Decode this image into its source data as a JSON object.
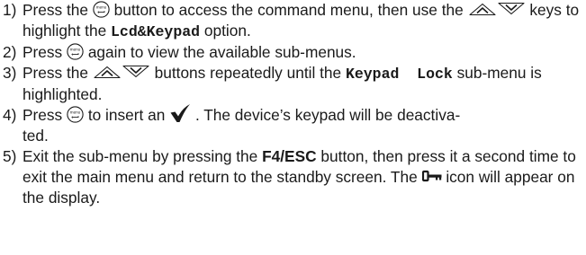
{
  "steps": [
    {
      "num": "1)",
      "t1": "Press the",
      "t2": "button to access the command menu, then use the",
      "t3": "keys to highlight the",
      "code": "Lcd&Keypad",
      "t4": "option."
    },
    {
      "num": "2)",
      "t1": "Press",
      "t2": "again to view the available sub-menus."
    },
    {
      "num": "3)",
      "t1": "Press the",
      "t2": "buttons repeatedly until the",
      "code": "Keypad  Lock",
      "t3": "sub-menu is highlighted."
    },
    {
      "num": "4)",
      "t1": "Press",
      "t2": "to insert an",
      "t3": ". The device’s keypad will be deactiva-",
      "t4": "ted."
    },
    {
      "num": "5)",
      "t1": "Exit the sub-menu by pressing the",
      "key": "F4/ESC",
      "t2": "button, then press it a second time to exit the main menu and return to the standby screen. The",
      "t3": "icon will appear on the display."
    }
  ],
  "icons": {
    "menu": "menu-button-icon",
    "up": "up-arrow-key-icon",
    "down": "down-arrow-key-icon",
    "check": "checkmark-icon",
    "lock": "key-lock-icon"
  }
}
